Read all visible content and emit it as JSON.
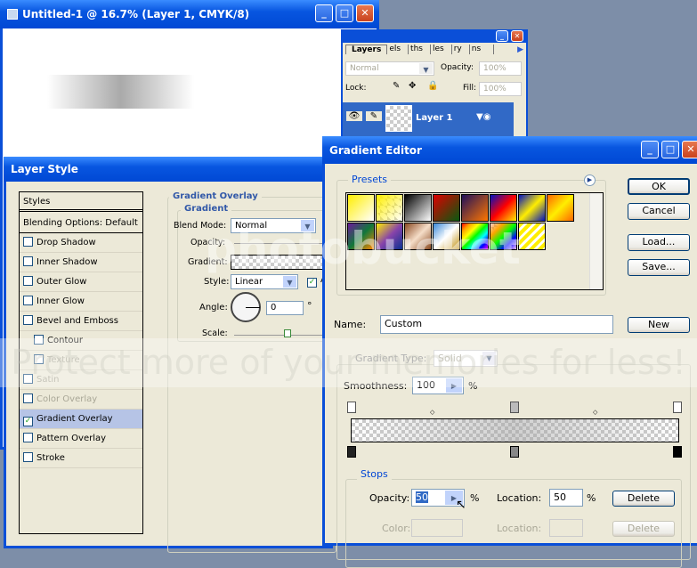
{
  "document": {
    "title": "Untitled-1 @ 16.7% (Layer 1, CMYK/8)"
  },
  "layers": {
    "tabs": [
      "Layers",
      "els",
      "ths",
      "les",
      "ry",
      "ns"
    ],
    "blend_mode": "Normal",
    "opacity_label": "Opacity:",
    "opacity": "100%",
    "lock_label": "Lock:",
    "fill_label": "Fill:",
    "fill": "100%",
    "layer_name": "Layer 1"
  },
  "layer_style": {
    "title": "Layer Style",
    "styles_header": "Styles",
    "blending": "Blending Options: Default",
    "items": [
      {
        "label": "Drop Shadow",
        "checked": false
      },
      {
        "label": "Inner Shadow",
        "checked": false
      },
      {
        "label": "Outer Glow",
        "checked": false
      },
      {
        "label": "Inner Glow",
        "checked": false
      },
      {
        "label": "Bevel and Emboss",
        "checked": false
      },
      {
        "label": "Contour",
        "checked": false
      },
      {
        "label": "Texture",
        "checked": false
      },
      {
        "label": "Satin",
        "checked": false
      },
      {
        "label": "Color Overlay",
        "checked": false
      },
      {
        "label": "Gradient Overlay",
        "checked": true
      },
      {
        "label": "Pattern Overlay",
        "checked": false
      },
      {
        "label": "Stroke",
        "checked": false
      }
    ],
    "section": "Gradient Overlay",
    "subsection": "Gradient",
    "blend_mode_label": "Blend Mode:",
    "blend_mode": "Normal",
    "opacity_label": "Opacity:",
    "gradient_label": "Gradient:",
    "style_label": "Style:",
    "style": "Linear",
    "align_label": "A",
    "angle_label": "Angle:",
    "angle": "0",
    "degree": "°",
    "scale_label": "Scale:"
  },
  "gradient_editor": {
    "title": "Gradient Editor",
    "presets_label": "Presets",
    "ok": "OK",
    "cancel": "Cancel",
    "load": "Load...",
    "save": "Save...",
    "name_label": "Name:",
    "name": "Custom",
    "new": "New",
    "type_label": "Gradient Type:",
    "type": "Solid",
    "smoothness_label": "Smoothness:",
    "smoothness": "100",
    "pct": "%",
    "stops_label": "Stops",
    "opacity_label": "Opacity:",
    "opacity": "50",
    "location_label": "Location:",
    "location": "50",
    "delete": "Delete",
    "color_label": "Color:",
    "color_location_label": "Location:",
    "color_delete": "Delete"
  },
  "watermark": {
    "brand": "photobucket",
    "tagline": "Protect more of your memories for less!"
  }
}
